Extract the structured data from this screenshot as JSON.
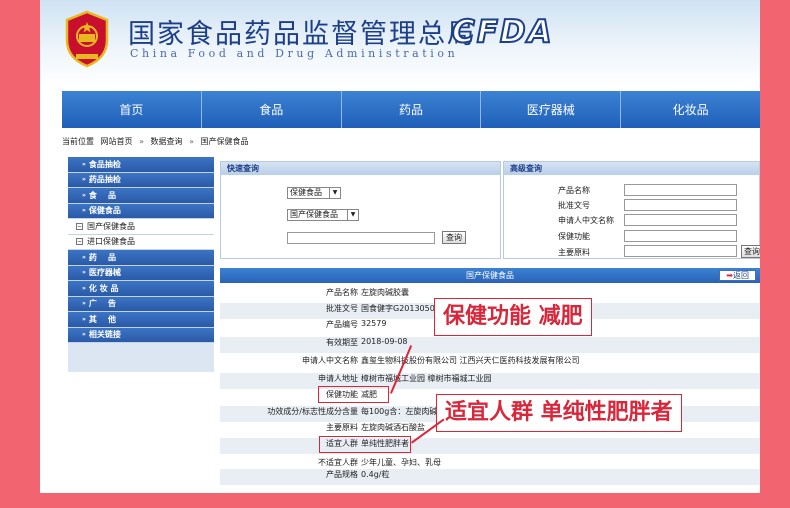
{
  "header": {
    "title_cn": "国家食品药品监督管理总局",
    "title_en": "China Food and Drug Administration",
    "brand": "CFDA"
  },
  "nav": {
    "items": [
      "首页",
      "食品",
      "药品",
      "医疗器械",
      "化妆品"
    ]
  },
  "breadcrumb": {
    "label": "当前位置",
    "items": [
      "网站首页",
      "数据查询",
      "国产保健食品"
    ],
    "separator": "»"
  },
  "sidebar": {
    "items": [
      {
        "label": "食品抽检",
        "type": "main"
      },
      {
        "label": "药品抽检",
        "type": "main"
      },
      {
        "label": "食    品",
        "type": "main"
      },
      {
        "label": "保健食品",
        "type": "main"
      },
      {
        "label": "国产保健食品",
        "type": "sub"
      },
      {
        "label": "进口保健食品",
        "type": "sub"
      },
      {
        "label": "药    品",
        "type": "main"
      },
      {
        "label": "医疗器械",
        "type": "main"
      },
      {
        "label": "化 妆 品",
        "type": "main"
      },
      {
        "label": "广    告",
        "type": "main"
      },
      {
        "label": "其    他",
        "type": "main"
      },
      {
        "label": "相关链接",
        "type": "main"
      }
    ]
  },
  "quick_search": {
    "title": "快速查询",
    "select1": "保健食品",
    "select2": "国产保健食品",
    "button": "查询"
  },
  "advanced_search": {
    "title": "高级查询",
    "fields": [
      "产品名称",
      "批准文号",
      "申请人中文名称",
      "保健功能",
      "主要原料"
    ],
    "button": "查询"
  },
  "detail": {
    "title": "国产保健食品",
    "back": "返回",
    "rows": [
      {
        "label": "产品名称",
        "value": "左旋肉碱胶囊"
      },
      {
        "label": "批准文号",
        "value": "国食健字G20130508"
      },
      {
        "label": "产品编号",
        "value": "32579"
      },
      {
        "label": "有效期至",
        "value": "2018-09-08"
      },
      {
        "label": "申请人中文名称",
        "value": "鑫玺生物科技股份有限公司 江西兴天仁医药科技发展有限公司"
      },
      {
        "label": "申请人地址",
        "value": "樟树市福城工业园 樟树市福城工业园"
      },
      {
        "label": "保健功能",
        "value": "减肥"
      },
      {
        "label": "功效成分/标志性成分含量",
        "value": "每100g含：左旋肉碱 69g"
      },
      {
        "label": "主要原料",
        "value": "左旋肉碱酒石酸盐"
      },
      {
        "label": "适宜人群",
        "value": "单纯性肥胖者"
      },
      {
        "label": "不适宜人群",
        "value": "少年儿童、孕妇、乳母"
      },
      {
        "label": "产品规格",
        "value": "0.4g/粒"
      }
    ]
  },
  "callouts": {
    "function": "保健功能  减肥",
    "population": "适宜人群 单纯性肥胖者"
  },
  "colors": {
    "background": "#f26470",
    "nav": "#2a6cc4",
    "accent_red": "#d8273a",
    "emblem_red": "#c8102e",
    "emblem_gold": "#e8b820"
  }
}
